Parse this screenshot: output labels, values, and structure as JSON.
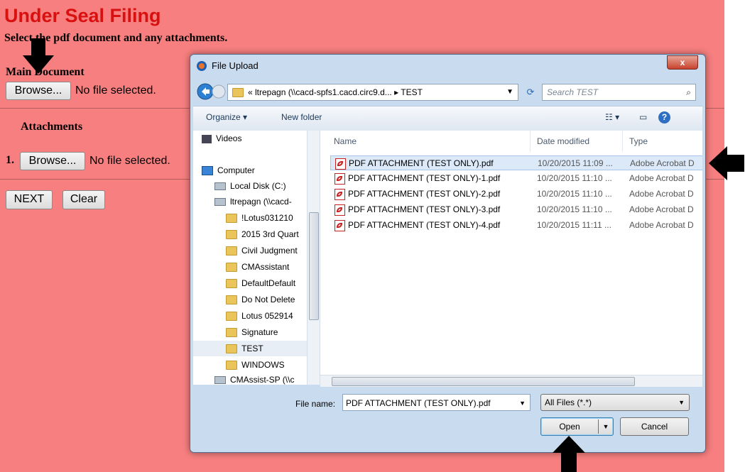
{
  "page": {
    "title": "Under Seal Filing",
    "subtitle": "Select the pdf document and any attachments.",
    "main_document_label": "Main Document",
    "browse_label": "Browse...",
    "no_file_text": "No file selected.",
    "attachments_label": "Attachments",
    "attachment_index": "1.",
    "next_label": "NEXT",
    "clear_label": "Clear"
  },
  "dialog": {
    "title": "File Upload",
    "close_label": "x",
    "address_path": "« ltrepagn (\\\\cacd-spfs1.cacd.circ9.d...  ▸  TEST",
    "search_placeholder": "Search TEST",
    "toolbar": {
      "organize": "Organize ▾",
      "new_folder": "New folder"
    },
    "nav_items": [
      "Videos",
      "Computer",
      "Local Disk (C:)",
      "ltrepagn (\\\\cacd-",
      "!Lotus031210",
      "2015 3rd Quart",
      "Civil Judgment",
      "CMAssistant",
      "DefaultDefault",
      "Do Not Delete",
      "Lotus 052914",
      "Signature",
      "TEST",
      "WINDOWS",
      "CMAssist-SP (\\\\c"
    ],
    "columns": [
      "Name",
      "Date modified",
      "Type"
    ],
    "files": [
      {
        "name": "PDF ATTACHMENT (TEST ONLY).pdf",
        "date": "10/20/2015 11:09 ...",
        "type": "Adobe Acrobat D"
      },
      {
        "name": "PDF ATTACHMENT (TEST ONLY)-1.pdf",
        "date": "10/20/2015 11:10 ...",
        "type": "Adobe Acrobat D"
      },
      {
        "name": "PDF ATTACHMENT (TEST ONLY)-2.pdf",
        "date": "10/20/2015 11:10 ...",
        "type": "Adobe Acrobat D"
      },
      {
        "name": "PDF ATTACHMENT (TEST ONLY)-3.pdf",
        "date": "10/20/2015 11:10 ...",
        "type": "Adobe Acrobat D"
      },
      {
        "name": "PDF ATTACHMENT (TEST ONLY)-4.pdf",
        "date": "10/20/2015 11:11 ...",
        "type": "Adobe Acrobat D"
      }
    ],
    "file_name_label": "File name:",
    "file_name_value": "PDF ATTACHMENT (TEST ONLY).pdf",
    "file_type": "All Files (*.*)",
    "open_label": "Open",
    "cancel_label": "Cancel"
  },
  "colors": {
    "page_bg": "#f77f7f",
    "title": "#d81010"
  }
}
